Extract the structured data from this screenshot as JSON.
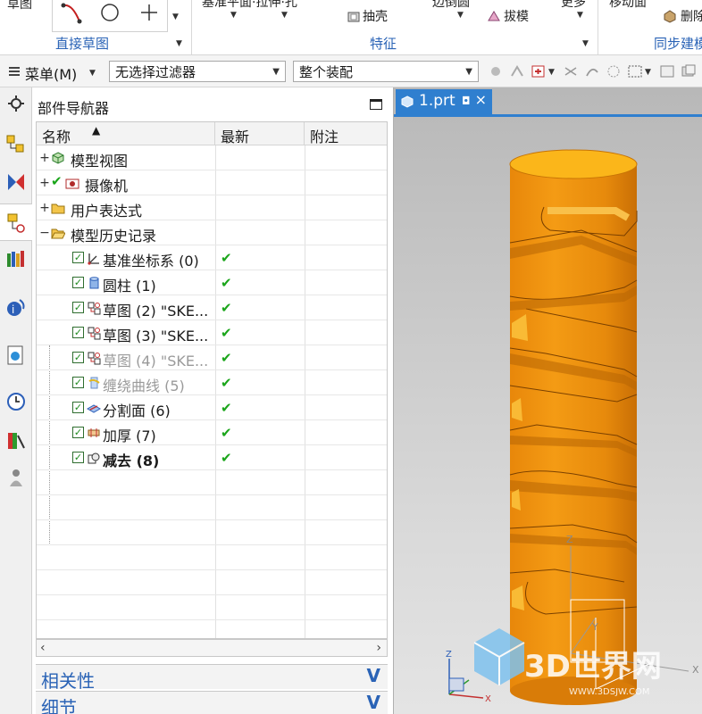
{
  "ribbon": {
    "partial_left_label": "草图",
    "sketch_group_label": "直接草图",
    "partial_datum_label": "基准平面·拉伸·孔",
    "shell_label": "抽壳",
    "partial_more_left": "边倒圆",
    "draft_label": "拔模",
    "partial_more": "更多",
    "feature_group_label": "特征",
    "partial_move_face": "移动面",
    "delete_face_partial": "删除",
    "sync_group_label": "同步建模"
  },
  "toolbar": {
    "menu_label": "菜单(M)",
    "filter_value": "无选择过滤器",
    "scope_value": "整个装配"
  },
  "navigator": {
    "title": "部件导航器",
    "columns": {
      "name": "名称",
      "latest": "最新",
      "notes": "附注"
    },
    "nodes": [
      {
        "label": "模型视图",
        "icon": "model-views-icon"
      },
      {
        "label": "摄像机",
        "icon": "camera-icon"
      },
      {
        "label": "用户表达式",
        "icon": "folder-icon"
      },
      {
        "label": "模型历史记录",
        "icon": "folder-open-icon"
      }
    ],
    "history": [
      {
        "label": "基准坐标系 (0)",
        "icon": "datum-csys-icon",
        "latest": true,
        "state": "normal"
      },
      {
        "label": "圆柱 (1)",
        "icon": "cylinder-icon",
        "latest": true,
        "state": "normal"
      },
      {
        "label": "草图 (2) \"SKE...",
        "icon": "sketch-icon",
        "latest": true,
        "state": "normal"
      },
      {
        "label": "草图 (3) \"SKE...",
        "icon": "sketch-icon",
        "latest": true,
        "state": "normal"
      },
      {
        "label": "草图 (4) \"SKE...",
        "icon": "sketch-icon",
        "latest": true,
        "state": "dim"
      },
      {
        "label": "缠绕曲线 (5)",
        "icon": "wrap-curve-icon",
        "latest": true,
        "state": "dim"
      },
      {
        "label": "分割面 (6)",
        "icon": "divide-face-icon",
        "latest": true,
        "state": "normal"
      },
      {
        "label": "加厚 (7)",
        "icon": "thicken-icon",
        "latest": true,
        "state": "normal"
      },
      {
        "label": "减去 (8)",
        "icon": "subtract-icon",
        "latest": true,
        "state": "current"
      }
    ],
    "sections": {
      "dependencies": "相关性",
      "details": "细节"
    }
  },
  "viewport": {
    "tab_label": "1.prt",
    "axes": {
      "z": "Z",
      "y": "Y",
      "x": "X"
    },
    "watermark_text": "3D世界网",
    "watermark_url": "WWW.3DSJW.COM"
  },
  "colors": {
    "accent": "#2a63b6",
    "tab_blue": "#2f7fcf",
    "model_orange": "#f0960f",
    "model_top": "#fbb61a",
    "check_green": "#1aa51a"
  }
}
